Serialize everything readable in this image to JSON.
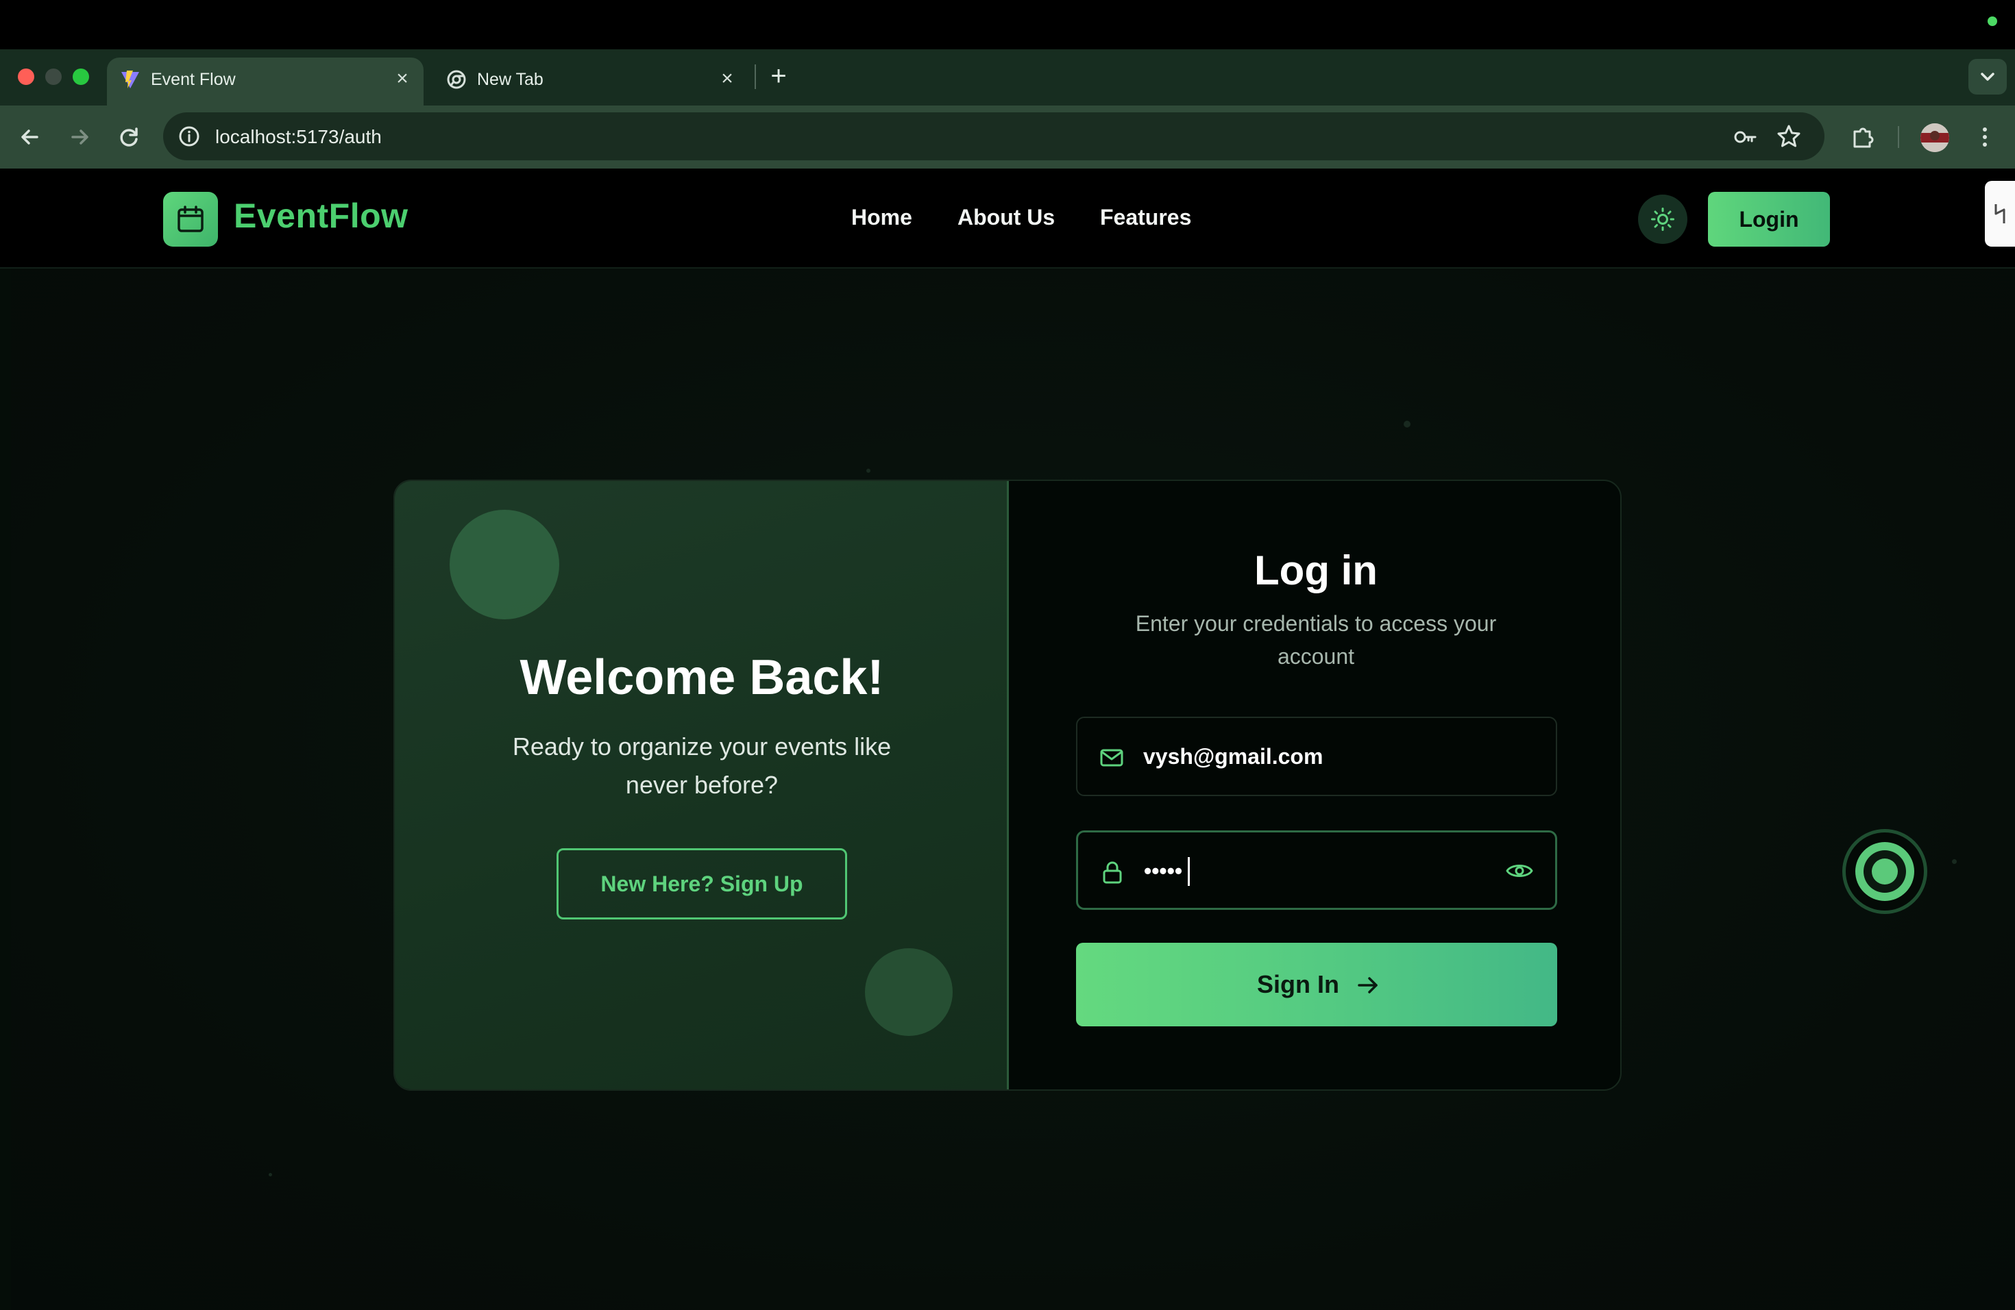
{
  "browser": {
    "tabs": [
      {
        "title": "Event Flow",
        "active": true,
        "favicon": "vite-logo-icon"
      },
      {
        "title": "New Tab",
        "active": false,
        "favicon": "chrome-icon"
      }
    ],
    "close_glyph": "×",
    "new_tab_glyph": "+",
    "url": "localhost:5173/auth"
  },
  "nav": {
    "brand": "EventFlow",
    "links": [
      "Home",
      "About Us",
      "Features"
    ],
    "login_label": "Login"
  },
  "welcome_panel": {
    "title": "Welcome Back!",
    "subtitle": "Ready to organize your events like never before?",
    "signup_label": "New Here? Sign Up"
  },
  "login_panel": {
    "title": "Log in",
    "subtitle": "Enter your credentials to access your account",
    "email_value": "vysh@gmail.com",
    "password_value": "•••••",
    "submit_label": "Sign In"
  },
  "colors": {
    "accent": "#4ccf6f",
    "accent_gradient_end": "#43b886",
    "page_background": "#050d08",
    "panel_background": "#1b3624"
  }
}
